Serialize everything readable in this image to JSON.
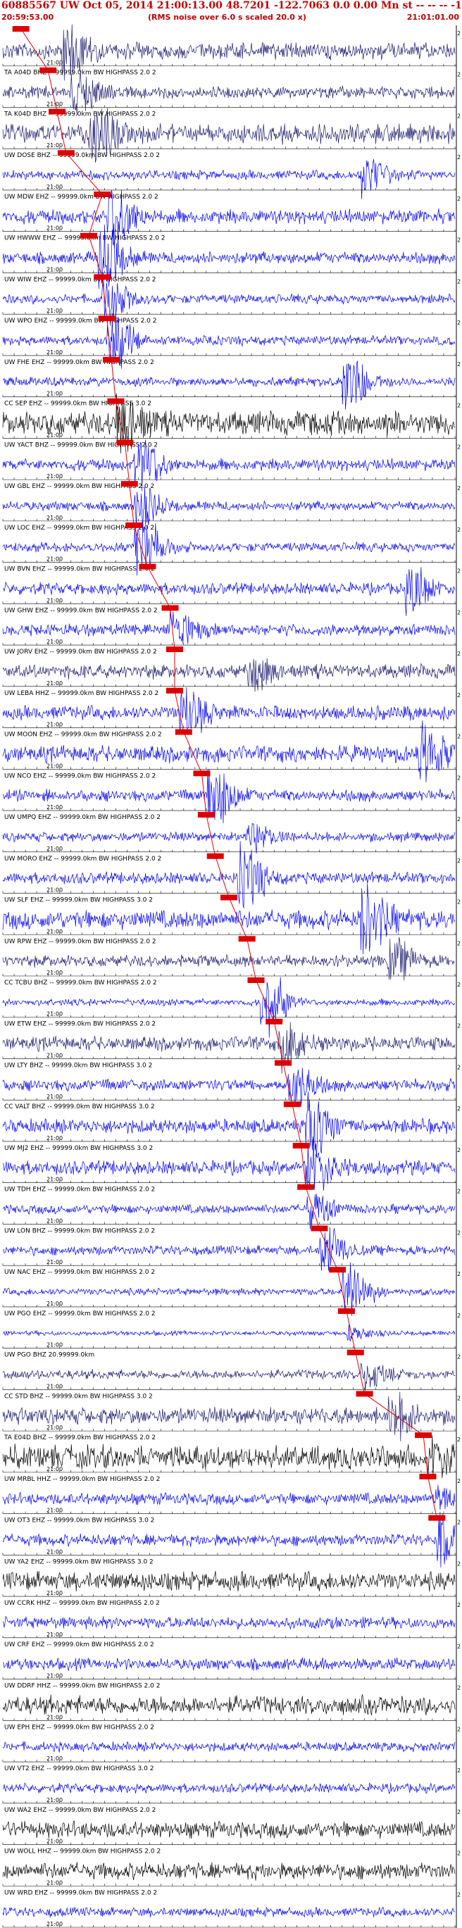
{
  "header": {
    "title": "60885567 UW Oct 05, 2014 21:00:13.00   48.7201 -122.7063  0.0 0.00 Mn st -- -- --  -1",
    "start_time": "20:59:53.00",
    "note": "(RMS noise over 6.0 s scaled 20.0 x)",
    "end_time": "21:01:01.00"
  },
  "colors": {
    "blue": "#0000ee",
    "navy": "#1a1a6e",
    "black": "#000000",
    "red": "#dd0000",
    "axis": "#000000"
  },
  "chart_data": {
    "type": "seismogram",
    "tick_label": "21:00",
    "right_label": "2",
    "traces": [
      {
        "label": "",
        "pick": 0.04,
        "color": "navy",
        "amp": 0.35,
        "burst": 0.14,
        "burst_amp": 0.9
      },
      {
        "label": "TA A04D BHZ -- 99999.0km BW  HIGHPASS  2.0  2",
        "pick": 0.1,
        "color": "navy",
        "amp": 0.25,
        "burst": 0.16,
        "burst_amp": 0.6
      },
      {
        "label": "TA K04D BHZ -- 99999.0km BW  HIGHPASS  2.0  2",
        "pick": 0.12,
        "color": "navy",
        "amp": 0.4,
        "burst": 0.2,
        "burst_amp": 0.8
      },
      {
        "label": "UW DOSE BHZ -- 99999.0km BW  HIGHPASS  2.0  2",
        "pick": 0.14,
        "color": "blue",
        "amp": 0.2,
        "burst": 0.8,
        "burst_amp": 0.6
      },
      {
        "label": "UW MDW EHZ -- 99999.0km BW  HIGHPASS  2.0  2",
        "pick": 0.22,
        "color": "blue",
        "amp": 0.3,
        "burst": 0.24,
        "burst_amp": 1.0
      },
      {
        "label": "UW HWWW EHZ -- 99999.0km BW  HIGHPASS  2.0  2",
        "pick": 0.19,
        "color": "blue",
        "amp": 0.25,
        "burst": 0.22,
        "burst_amp": 1.0
      },
      {
        "label": "UW WIW EHZ -- 99999.0km BW  HIGHPASS  2.0  2",
        "pick": 0.22,
        "color": "blue",
        "amp": 0.2,
        "burst": 0.23,
        "burst_amp": 0.7
      },
      {
        "label": "UW WPO EHZ -- 99999.0km BW  HIGHPASS  2.0  2",
        "pick": 0.23,
        "color": "blue",
        "amp": 0.2,
        "burst": 0.24,
        "burst_amp": 0.9
      },
      {
        "label": "UW FHE EHZ -- 99999.0km BW  HIGHPASS  2.0  2",
        "pick": 0.24,
        "color": "blue",
        "amp": 0.2,
        "burst": 0.76,
        "burst_amp": 0.9
      },
      {
        "label": "CC SEP EHZ -- 99999.0km BW  HIGHPASS  3.0  2",
        "pick": 0.25,
        "color": "black",
        "amp": 0.5,
        "burst": 0.26,
        "burst_amp": 0.8
      },
      {
        "label": "UW YACT BHZ -- 99999.0km BW  HIGHPASS  2.0  2",
        "pick": 0.27,
        "color": "blue",
        "amp": 0.25,
        "burst": 0.3,
        "burst_amp": 0.9
      },
      {
        "label": "UW GBL EHZ -- 99999.0km BW  HIGHPASS  2.0  2",
        "pick": 0.28,
        "color": "blue",
        "amp": 0.2,
        "burst": 0.3,
        "burst_amp": 0.6
      },
      {
        "label": "UW LOC EHZ -- 99999.0km BW  HIGHPASS  2.0  2",
        "pick": 0.29,
        "color": "blue",
        "amp": 0.2,
        "burst": 0.3,
        "burst_amp": 0.9
      },
      {
        "label": "UW BVN EHZ -- 99999.0km BW  HIGHPASS  2.0  2",
        "pick": 0.32,
        "color": "blue",
        "amp": 0.25,
        "burst": 0.9,
        "burst_amp": 0.7
      },
      {
        "label": "UW GHW EHZ -- 99999.0km BW  HIGHPASS  2.0  2",
        "pick": 0.37,
        "color": "blue",
        "amp": 0.25,
        "burst": 0.38,
        "burst_amp": 0.5
      },
      {
        "label": "UW JORV EHZ -- 99999.0km BW  HIGHPASS  2.0  2",
        "pick": 0.38,
        "color": "navy",
        "amp": 0.3,
        "burst": 0.55,
        "burst_amp": 0.5
      },
      {
        "label": "UW LEBA HHZ -- 99999.0km BW  HIGHPASS  2.0  2",
        "pick": 0.38,
        "color": "blue",
        "amp": 0.3,
        "burst": 0.4,
        "burst_amp": 0.7
      },
      {
        "label": "UW MOON EHZ -- 99999.0km BW  HIGHPASS  2.0  2",
        "pick": 0.4,
        "color": "blue",
        "amp": 0.35,
        "burst": 0.93,
        "burst_amp": 0.8
      },
      {
        "label": "UW NCO EHZ -- 99999.0km BW  HIGHPASS  2.0  2",
        "pick": 0.44,
        "color": "blue",
        "amp": 0.25,
        "burst": 0.46,
        "burst_amp": 1.0
      },
      {
        "label": "UW UMPQ EHZ -- 99999.0km BW  HIGHPASS  2.0  2",
        "pick": 0.45,
        "color": "blue",
        "amp": 0.2,
        "burst": 0.55,
        "burst_amp": 0.4
      },
      {
        "label": "UW MORO EHZ -- 99999.0km BW  HIGHPASS  2.0  2",
        "pick": 0.47,
        "color": "blue",
        "amp": 0.25,
        "burst": 0.53,
        "burst_amp": 0.9
      },
      {
        "label": "UW SLF EHZ -- 99999.0km BW  HIGHPASS  3.0  2",
        "pick": 0.5,
        "color": "blue",
        "amp": 0.4,
        "burst": 0.8,
        "burst_amp": 1.0
      },
      {
        "label": "UW RPW EHZ -- 99999.0km BW  HIGHPASS  2.0  2",
        "pick": 0.54,
        "color": "navy",
        "amp": 0.25,
        "burst": 0.86,
        "burst_amp": 0.6
      },
      {
        "label": "CC TCBU BHZ -- 99999.0km BW  HIGHPASS  2.0  2",
        "pick": 0.56,
        "color": "blue",
        "amp": 0.15,
        "burst": 0.58,
        "burst_amp": 1.0
      },
      {
        "label": "UW ETW EHZ -- 99999.0km BW  HIGHPASS  2.0  2",
        "pick": 0.6,
        "color": "navy",
        "amp": 0.3,
        "burst": 0.62,
        "burst_amp": 0.7
      },
      {
        "label": "UW LTY BHZ -- 99999.0km BW  HIGHPASS  3.0  2",
        "pick": 0.62,
        "color": "blue",
        "amp": 0.25,
        "burst": 0.64,
        "burst_amp": 0.7
      },
      {
        "label": "CC VALT BHZ -- 99999.0km BW  HIGHPASS  3.0  2",
        "pick": 0.64,
        "color": "blue",
        "amp": 0.3,
        "burst": 0.68,
        "burst_amp": 1.0
      },
      {
        "label": "UW MJ2 EHZ -- 99999.0km BW  HIGHPASS  3.0  2",
        "pick": 0.66,
        "color": "blue",
        "amp": 0.3,
        "burst": 0.68,
        "burst_amp": 0.8
      },
      {
        "label": "UW TDH EHZ -- 99999.0km BW  HIGHPASS  2.0  2",
        "pick": 0.67,
        "color": "blue",
        "amp": 0.2,
        "burst": 0.68,
        "burst_amp": 0.5
      },
      {
        "label": "UW LON BHZ -- 99999.0km BW  HIGHPASS  2.0  2",
        "pick": 0.7,
        "color": "blue",
        "amp": 0.2,
        "burst": 0.71,
        "burst_amp": 0.7
      },
      {
        "label": "UW NAC EHZ -- 99999.0km BW  HIGHPASS  2.0  2",
        "pick": 0.74,
        "color": "blue",
        "amp": 0.15,
        "burst": 0.76,
        "burst_amp": 1.0
      },
      {
        "label": "UW PGO EHZ -- 99999.0km BW  HIGHPASS  2.0  2",
        "pick": 0.76,
        "color": "blue",
        "amp": 0.1,
        "burst": 0.77,
        "burst_amp": 0.2
      },
      {
        "label": "UW PGO BHZ  20.99999.0km",
        "pick": 0.78,
        "color": "navy",
        "amp": 0.2,
        "burst": 0.8,
        "burst_amp": 0.4
      },
      {
        "label": "CC STD BHZ -- 99999.0km BW  HIGHPASS  3.0  2",
        "pick": 0.8,
        "color": "navy",
        "amp": 0.35,
        "burst": 0.86,
        "burst_amp": 0.6
      },
      {
        "label": "TA E04D BHZ -- 99999.0km BW  HIGHPASS  2.0  2",
        "pick": 0.93,
        "color": "black",
        "amp": 0.5,
        "burst": 0.95,
        "burst_amp": 0.5
      },
      {
        "label": "UW MRBL HHZ -- 99999.0km BW  HIGHPASS  2.0  2",
        "pick": 0.94,
        "color": "blue",
        "amp": 0.25,
        "burst": 0.96,
        "burst_amp": 0.3
      },
      {
        "label": "UW OT3 EHZ -- 99999.0km BW  HIGHPASS  3.0  2",
        "pick": 0.96,
        "color": "blue",
        "amp": 0.25,
        "burst": 0.97,
        "burst_amp": 0.8
      },
      {
        "label": "UW YA2 EHZ -- 99999.0km BW  HIGHPASS  3.0  2",
        "pick": null,
        "color": "black",
        "amp": 0.4,
        "burst": null,
        "burst_amp": 0
      },
      {
        "label": "UW CCRK HHZ -- 99999.0km BW  HIGHPASS  2.0  2",
        "pick": null,
        "color": "blue",
        "amp": 0.25,
        "burst": null,
        "burst_amp": 0
      },
      {
        "label": "UW CRF EHZ -- 99999.0km BW  HIGHPASS  2.0  2",
        "pick": null,
        "color": "blue",
        "amp": 0.25,
        "burst": null,
        "burst_amp": 0
      },
      {
        "label": "UW DDRF HHZ -- 99999.0km BW  HIGHPASS  2.0  2",
        "pick": null,
        "color": "black",
        "amp": 0.4,
        "burst": null,
        "burst_amp": 0
      },
      {
        "label": "UW EPH EHZ -- 99999.0km BW  HIGHPASS  2.0  2",
        "pick": null,
        "color": "blue",
        "amp": 0.2,
        "burst": null,
        "burst_amp": 0
      },
      {
        "label": "UW VT2 EHZ -- 99999.0km BW  HIGHPASS  3.0  2",
        "pick": null,
        "color": "blue",
        "amp": 0.2,
        "burst": null,
        "burst_amp": 0
      },
      {
        "label": "UW WA2 EHZ -- 99999.0km BW  HIGHPASS  2.0  2",
        "pick": null,
        "color": "black",
        "amp": 0.35,
        "burst": null,
        "burst_amp": 0
      },
      {
        "label": "UW WOLL HHZ -- 99999.0km BW  HIGHPASS  2.0  2",
        "pick": null,
        "color": "black",
        "amp": 0.35,
        "burst": null,
        "burst_amp": 0
      },
      {
        "label": "UW WRD EHZ -- 99999.0km BW  HIGHPASS  2.0  2",
        "pick": null,
        "color": "blue",
        "amp": 0.2,
        "burst": null,
        "burst_amp": 0
      }
    ]
  }
}
